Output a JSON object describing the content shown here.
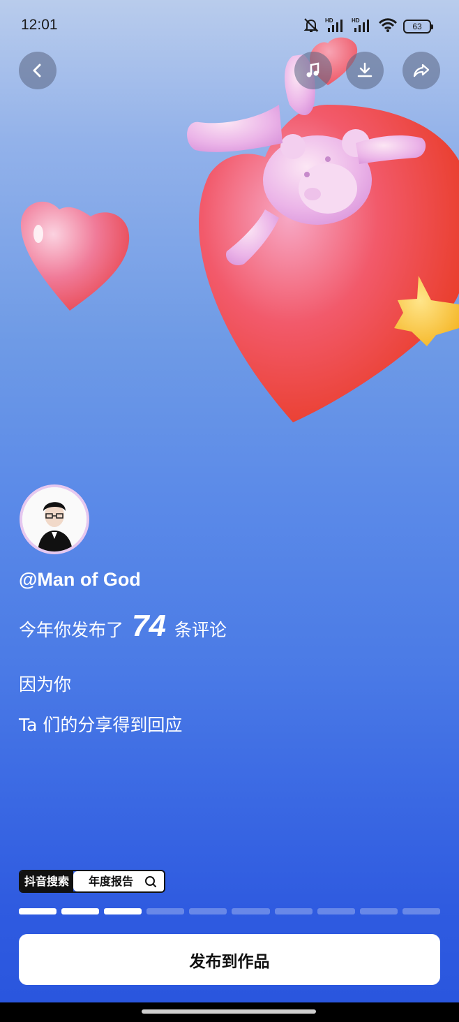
{
  "status_bar": {
    "time": "12:01",
    "battery": "63",
    "icons": [
      "mute-bell-icon",
      "hd-signal-icon",
      "hd-signal-icon",
      "wifi-icon",
      "battery-icon"
    ]
  },
  "top_buttons": [
    "back-icon",
    "music-icon",
    "download-icon",
    "share-icon"
  ],
  "profile": {
    "username": "@Man of God"
  },
  "message": {
    "line1_prefix": "今年你发布了",
    "count": "74",
    "line1_suffix": "条评论",
    "line2": "因为你",
    "line3": "Ta 们的分享得到回应"
  },
  "search_tag": {
    "brand": "抖音搜索",
    "query": "年度报告"
  },
  "progress": {
    "total_segments": 10,
    "completed_segments": 3
  },
  "actions": {
    "publish_label": "发布到作品"
  }
}
